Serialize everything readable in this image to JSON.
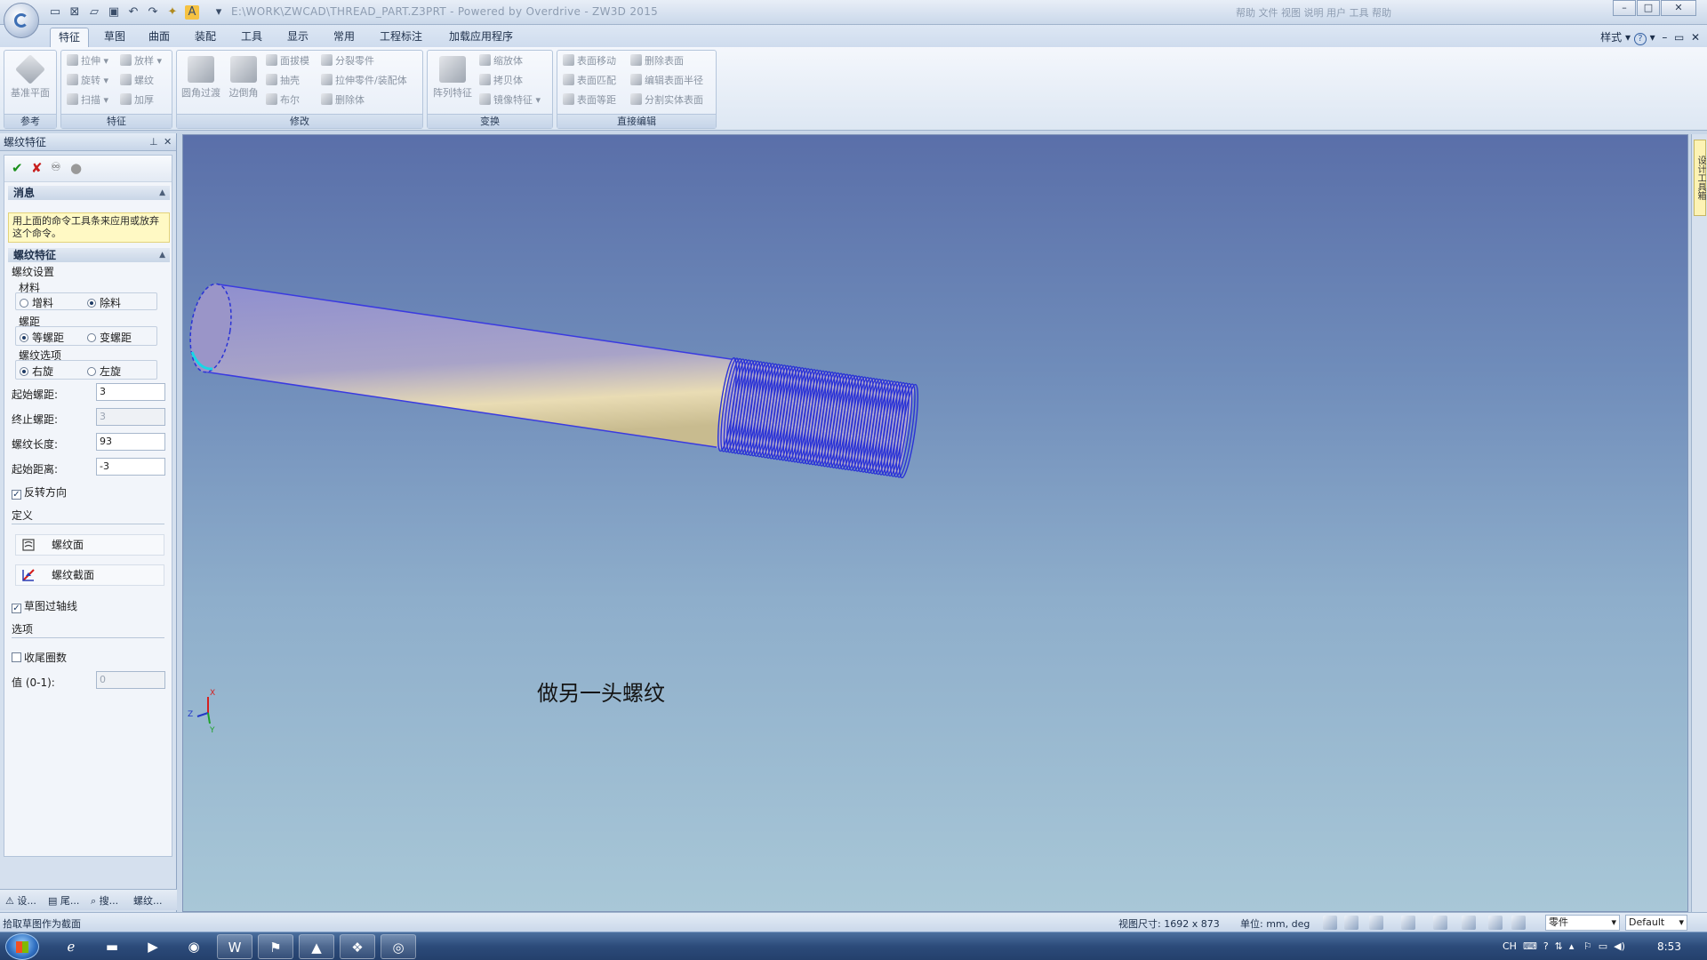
{
  "titlebar": {
    "title": "E:\\WORK\\ZWCAD\\THREAD_PART.Z3PRT - Powered by Overdrive - ZW3D 2015",
    "tools": "帮助  文件  视图  说明  用户  工具  帮助",
    "qat_icons": [
      "new-icon",
      "save-close-icon",
      "open-icon",
      "save-icon",
      "undo-icon",
      "redo-icon",
      "lightbulb-icon",
      "font-icon"
    ]
  },
  "ribbon": {
    "tabs": [
      "特征",
      "草图",
      "曲面",
      "装配",
      "工具",
      "显示",
      "常用",
      "工程标注",
      "加载应用程序"
    ],
    "active_tab": "特征",
    "style_label": "样式",
    "groups": {
      "reference": {
        "label": "参考",
        "datum": "基准平面"
      },
      "feature": {
        "label": "特征",
        "extrude": "拉伸",
        "loft": "放样",
        "revolve": "旋转",
        "thread": "螺纹",
        "sweep": "扫描",
        "thicken": "加厚"
      },
      "modify": {
        "label": "修改",
        "fillet": "圆角过渡",
        "chamfer": "边倒角",
        "draft": "面拔模",
        "shell": "抽壳",
        "boolean": "布尔",
        "split": "分裂零件",
        "extrude_part": "拉伸零件/装配体",
        "delete_body": "删除体"
      },
      "transform": {
        "label": "变换",
        "pattern": "阵列特征",
        "scale": "缩放体",
        "copy": "拷贝体",
        "mirror": "镜像特征"
      },
      "direct_edit": {
        "label": "直接编辑",
        "move_face": "表面移动",
        "delete_face": "删除表面",
        "match_face": "表面匹配",
        "edit_radius": "编辑表面半径",
        "offset_face": "表面等距",
        "split_solid": "分割实体表面"
      }
    }
  },
  "panel": {
    "title": "螺纹特征",
    "message_header": "消息",
    "message": "用上面的命令工具条来应用或放弃这个命令。",
    "section_header": "螺纹特征",
    "thread_settings": "螺纹设置",
    "material": {
      "label": "材料",
      "add": "增料",
      "remove": "除料",
      "selected": "除料"
    },
    "pitch": {
      "label": "螺距",
      "equal": "等螺距",
      "variable": "变螺距",
      "selected": "等螺距"
    },
    "direction": {
      "label": "螺纹选项",
      "right": "右旋",
      "left": "左旋",
      "selected": "右旋"
    },
    "fields": {
      "start_pitch": {
        "label": "起始螺距:",
        "value": "3"
      },
      "end_pitch": {
        "label": "终止螺距:",
        "value": "3"
      },
      "length": {
        "label": "螺纹长度:",
        "value": "93"
      },
      "start_distance": {
        "label": "起始距离:",
        "value": "-3"
      }
    },
    "reverse": "反转方向",
    "define": "定义",
    "thread_face": "螺纹面",
    "thread_section": "螺纹截面",
    "sketch_axis": "草图过轴线",
    "options": "选项",
    "tail_turns": "收尾圈数",
    "value_label": "值 (0-1):",
    "value": "0",
    "bottom_tabs": [
      "设...",
      "尾...",
      "搜...",
      "螺纹..."
    ]
  },
  "viewport": {
    "annotation": "做另一头螺纹",
    "triad": {
      "x": "X",
      "y": "Y",
      "z": "Z"
    },
    "right_strip": "设计工具箱"
  },
  "statusbar": {
    "message": "拾取草图作为截面",
    "view_size": "视图尺寸: 1692 x 873",
    "units": "单位: mm, deg",
    "filter": "零件",
    "style": "Default"
  },
  "taskbar": {
    "tray": "CH",
    "clock": "8:53"
  },
  "colors": {
    "viewport_top": "#5a6fa9",
    "viewport_bottom": "#a8c7d7",
    "thread_blue": "#2a33d6",
    "message_bg": "#fff9c4"
  }
}
